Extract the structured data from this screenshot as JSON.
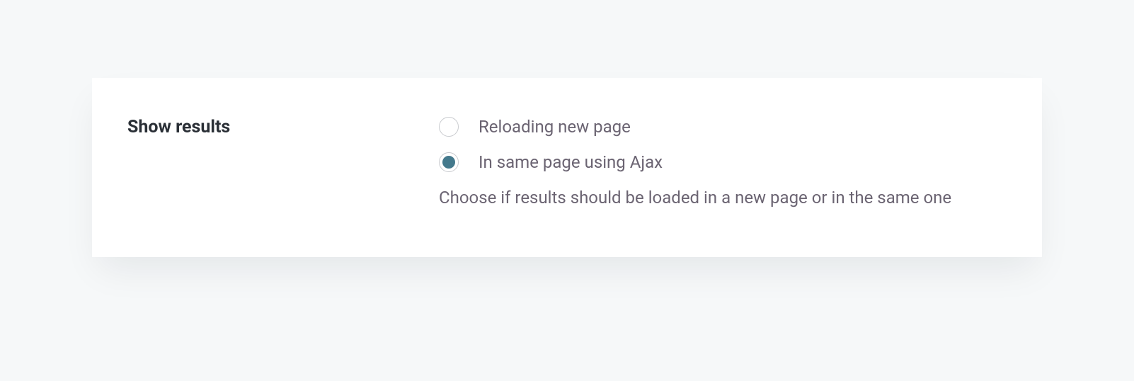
{
  "setting": {
    "title": "Show results",
    "options": [
      {
        "label": "Reloading new page",
        "selected": false
      },
      {
        "label": "In same page using Ajax",
        "selected": true
      }
    ],
    "help": "Choose if results should be loaded in a new page or in the same one"
  }
}
